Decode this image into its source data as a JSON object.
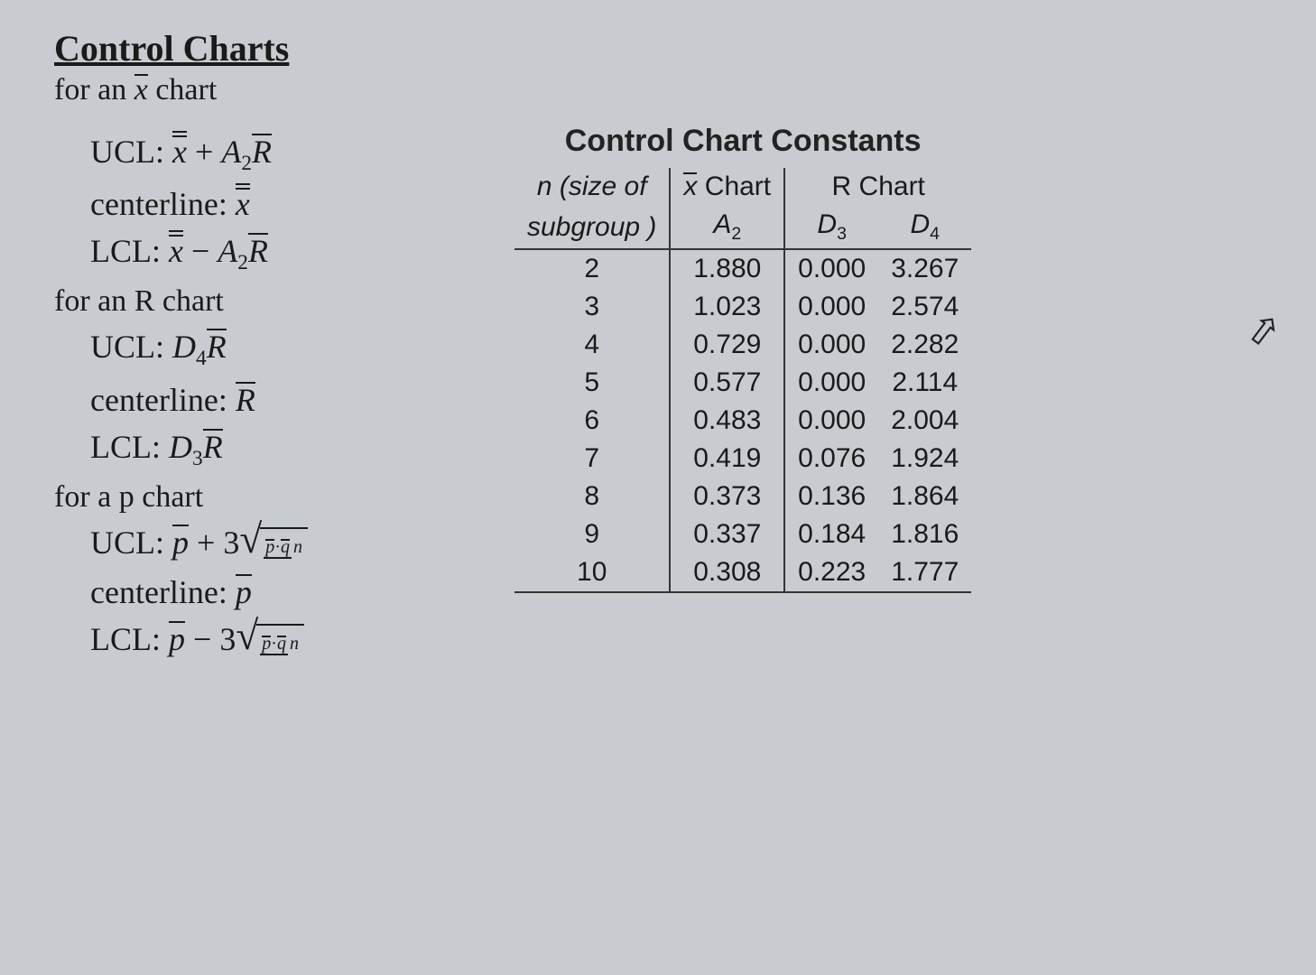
{
  "title": "Control Charts",
  "xbar_intro_prefix": "for an ",
  "xbar_intro_suffix": " chart",
  "x_sym": "x",
  "labels": {
    "ucl": "UCL:",
    "lcl": "LCL:",
    "centerline": "centerline:"
  },
  "formulas": {
    "r_intro": "for an R chart",
    "p_intro": "for a p chart",
    "A2": "A",
    "A2_sub": "2",
    "D3": "D",
    "D3_sub": "3",
    "D4": "D",
    "D4_sub": "4",
    "R": "R",
    "p": "p",
    "q": "q",
    "n": "n",
    "three": "3",
    "dot": "·"
  },
  "table": {
    "title": "Control Chart Constants",
    "col_n_l1": "n",
    "col_n_l1_suffix": " (size of",
    "col_n_l2": "subgroup )",
    "col_x_prefix": "x",
    "col_x_suffix": " Chart",
    "col_r": "R Chart",
    "sub_a2": "A",
    "sub_a2_s": "2",
    "sub_d3": "D",
    "sub_d3_s": "3",
    "sub_d4": "D",
    "sub_d4_s": "4",
    "rows": [
      {
        "n": "2",
        "a2": "1.880",
        "d3": "0.000",
        "d4": "3.267"
      },
      {
        "n": "3",
        "a2": "1.023",
        "d3": "0.000",
        "d4": "2.574"
      },
      {
        "n": "4",
        "a2": "0.729",
        "d3": "0.000",
        "d4": "2.282"
      },
      {
        "n": "5",
        "a2": "0.577",
        "d3": "0.000",
        "d4": "2.114"
      },
      {
        "n": "6",
        "a2": "0.483",
        "d3": "0.000",
        "d4": "2.004"
      },
      {
        "n": "7",
        "a2": "0.419",
        "d3": "0.076",
        "d4": "1.924"
      },
      {
        "n": "8",
        "a2": "0.373",
        "d3": "0.136",
        "d4": "1.864"
      },
      {
        "n": "9",
        "a2": "0.337",
        "d3": "0.184",
        "d4": "1.816"
      },
      {
        "n": "10",
        "a2": "0.308",
        "d3": "0.223",
        "d4": "1.777"
      }
    ]
  },
  "chart_data": {
    "type": "table",
    "title": "Control Chart Constants",
    "columns": [
      "n (size of subgroup)",
      "A2 (x̄ Chart)",
      "D3 (R Chart)",
      "D4 (R Chart)"
    ],
    "rows": [
      [
        2,
        1.88,
        0.0,
        3.267
      ],
      [
        3,
        1.023,
        0.0,
        2.574
      ],
      [
        4,
        0.729,
        0.0,
        2.282
      ],
      [
        5,
        0.577,
        0.0,
        2.114
      ],
      [
        6,
        0.483,
        0.0,
        2.004
      ],
      [
        7,
        0.419,
        0.076,
        1.924
      ],
      [
        8,
        0.373,
        0.136,
        1.864
      ],
      [
        9,
        0.337,
        0.184,
        1.816
      ],
      [
        10,
        0.308,
        0.223,
        1.777
      ]
    ]
  }
}
